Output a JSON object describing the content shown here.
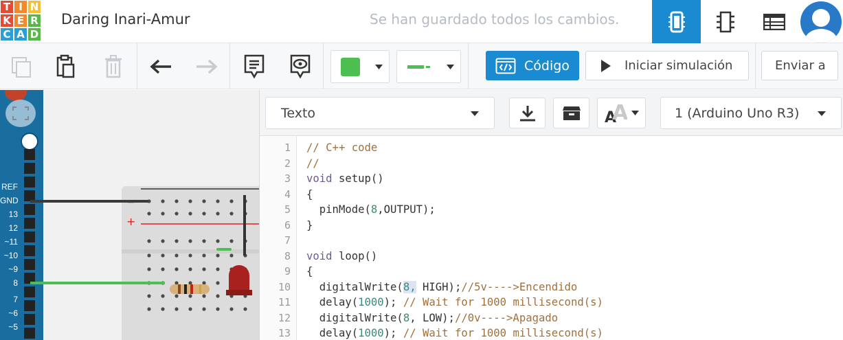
{
  "app": {
    "logo_letters": [
      "T",
      "I",
      "N",
      "K",
      "E",
      "R",
      "C",
      "A",
      "D"
    ],
    "logo_colors": [
      "#e44b33",
      "#f08a2a",
      "#f5c132",
      "#e44b33",
      "#f08a2a",
      "#58b847",
      "#2a9fd6",
      "#2a9fd6",
      "#58b847"
    ],
    "project_title": "Daring Inari-Amur",
    "save_status": "Se han guardado todos los cambios."
  },
  "header": {
    "views": [
      {
        "name": "circuit-view",
        "icon": "circuit-board-icon",
        "active": true
      },
      {
        "name": "schematic-view",
        "icon": "chip-icon",
        "active": false
      },
      {
        "name": "component-list-view",
        "icon": "table-list-icon",
        "active": false
      }
    ]
  },
  "toolbar": {
    "code_label": "Código",
    "simulate_label": "Iniciar simulación",
    "send_label": "Enviar a",
    "fill_color": "#4dbe50",
    "wire_color": "#4dbe50"
  },
  "code_toolbar": {
    "mode_label": "Texto",
    "device_label": "1 (Arduino Uno R3)"
  },
  "arduino": {
    "pins": [
      "REF",
      "GND",
      "13",
      "12",
      "~11",
      "~10",
      "~9",
      "8",
      "7",
      "~6",
      "~5"
    ]
  },
  "code": {
    "lines": [
      {
        "n": "1",
        "tokens": [
          {
            "t": "// C++ code",
            "c": "cm"
          }
        ]
      },
      {
        "n": "2",
        "tokens": [
          {
            "t": "//",
            "c": "cm"
          }
        ]
      },
      {
        "n": "3",
        "tokens": [
          {
            "t": "void",
            "c": "kw"
          },
          {
            "t": " setup()",
            "c": ""
          }
        ]
      },
      {
        "n": "4",
        "tokens": [
          {
            "t": "{",
            "c": ""
          }
        ]
      },
      {
        "n": "5",
        "tokens": [
          {
            "t": "  pinMode(",
            "c": ""
          },
          {
            "t": "8",
            "c": "nm"
          },
          {
            "t": ",OUTPUT);",
            "c": ""
          }
        ]
      },
      {
        "n": "6",
        "tokens": [
          {
            "t": "}",
            "c": ""
          }
        ]
      },
      {
        "n": "7",
        "tokens": [
          {
            "t": "",
            "c": ""
          }
        ]
      },
      {
        "n": "8",
        "tokens": [
          {
            "t": "void",
            "c": "kw"
          },
          {
            "t": " loop()",
            "c": ""
          }
        ]
      },
      {
        "n": "9",
        "tokens": [
          {
            "t": "{",
            "c": ""
          }
        ]
      },
      {
        "n": "10",
        "tokens": [
          {
            "t": "  digitalWrite(",
            "c": ""
          },
          {
            "t": "8,",
            "c": "nm hl"
          },
          {
            "t": " HIGH);",
            "c": ""
          },
          {
            "t": "//5v---->Encendido",
            "c": "cm"
          }
        ]
      },
      {
        "n": "11",
        "tokens": [
          {
            "t": "  delay(",
            "c": ""
          },
          {
            "t": "1000",
            "c": "nm"
          },
          {
            "t": "); ",
            "c": ""
          },
          {
            "t": "// Wait for 1000 millisecond(s)",
            "c": "cm"
          }
        ]
      },
      {
        "n": "12",
        "tokens": [
          {
            "t": "  digitalWrite(",
            "c": ""
          },
          {
            "t": "8",
            "c": "nm"
          },
          {
            "t": ", LOW);",
            "c": ""
          },
          {
            "t": "//0v---->Apagado",
            "c": "cm"
          }
        ]
      },
      {
        "n": "13",
        "tokens": [
          {
            "t": "  delay(",
            "c": ""
          },
          {
            "t": "1000",
            "c": "nm"
          },
          {
            "t": "); ",
            "c": ""
          },
          {
            "t": "// Wait for 1000 millisecond(s)",
            "c": "cm"
          }
        ]
      }
    ]
  }
}
